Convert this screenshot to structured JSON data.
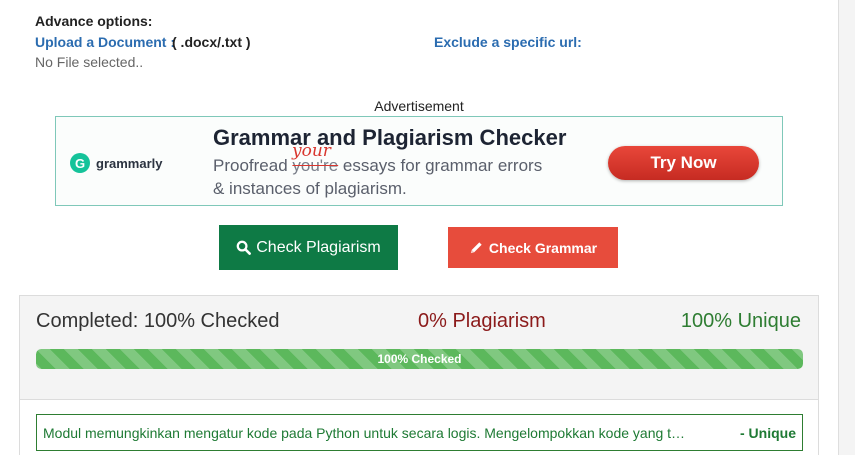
{
  "advanced": {
    "title": "Advance options:",
    "upload_label": "Upload a Document :",
    "upload_ext": "( .docx/.txt )",
    "no_file_text": "No File selected..",
    "exclude_label": "Exclude a specific url:"
  },
  "ad": {
    "label": "Advertisement",
    "brand": "grammarly",
    "brand_initial": "G",
    "headline": "Grammar and Plagiarism Checker",
    "line1_prefix": "Proofread ",
    "line1_struck": "you're",
    "line1_suffix": " essays for grammar errors",
    "line1_correction": "your",
    "line2": "& instances of plagiarism.",
    "cta": "Try Now"
  },
  "buttons": {
    "check_plagiarism": "Check Plagiarism",
    "check_grammar": "Check Grammar"
  },
  "results": {
    "completed_text": "Completed: 100% Checked",
    "plagiarism_text": "0% Plagiarism",
    "unique_text": "100% Unique",
    "progress_label": "100% Checked",
    "progress_value": 1.0
  },
  "sentences": [
    {
      "text": "Modul memungkinkan mengatur kode pada Python untuk secara logis. Mengelompokkan kode yang t…",
      "status": "- Unique"
    }
  ],
  "colors": {
    "primary_green": "#0e7a45",
    "grammar_red": "#e74c3c",
    "progress_green": "#5cb85c",
    "plagiarism_red": "#8b1a1a",
    "unique_green": "#2e7d32",
    "link_blue": "#2b6cb0"
  },
  "icons": {
    "check_plagiarism": "search-icon",
    "check_grammar": "pencil-icon"
  }
}
